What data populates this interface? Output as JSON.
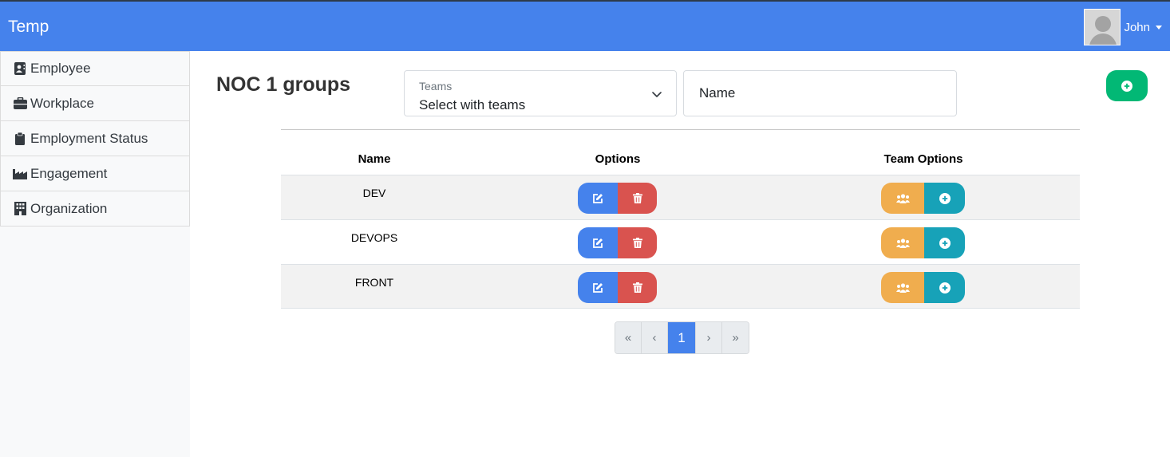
{
  "app": {
    "brand": "Temp"
  },
  "user": {
    "name": "John"
  },
  "sidebar": {
    "items": [
      {
        "label": "Employee",
        "icon": "id-badge-icon"
      },
      {
        "label": "Workplace",
        "icon": "briefcase-icon"
      },
      {
        "label": "Employment Status",
        "icon": "clipboard-icon"
      },
      {
        "label": "Engagement",
        "icon": "industry-icon"
      },
      {
        "label": "Organization",
        "icon": "building-icon"
      }
    ]
  },
  "page": {
    "title": "NOC 1 groups"
  },
  "filters": {
    "teams_label": "Teams",
    "teams_value": "Select with teams",
    "name_placeholder": "Name"
  },
  "table": {
    "headers": {
      "name": "Name",
      "options": "Options",
      "team_options": "Team Options"
    },
    "rows": [
      {
        "name": "DEV"
      },
      {
        "name": "DEVOPS"
      },
      {
        "name": "FRONT"
      }
    ]
  },
  "pagination": {
    "first": "«",
    "prev": "‹",
    "current": "1",
    "next": "›",
    "last": "»"
  },
  "colors": {
    "primary": "#4582ec",
    "success": "#02b875",
    "danger": "#d9534f",
    "warning": "#f0ad4e",
    "info": "#17a2b8"
  }
}
